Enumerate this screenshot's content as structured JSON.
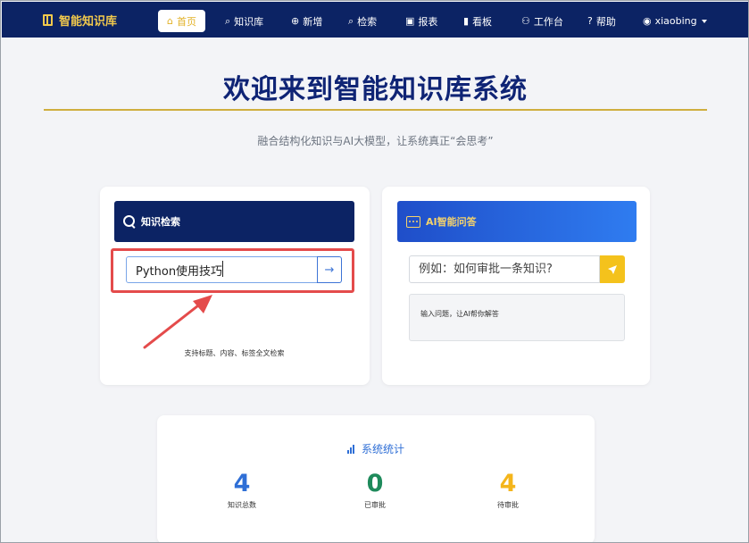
{
  "navbar": {
    "brand": "智能知识库",
    "items": [
      {
        "label": "首页",
        "icon": "home-icon",
        "glyph": "⌂",
        "active": true
      },
      {
        "label": "知识库",
        "icon": "search-icon",
        "glyph": "⌕"
      },
      {
        "label": "新增",
        "icon": "plus-circle-icon",
        "glyph": "⊕"
      },
      {
        "label": "检索",
        "icon": "search-icon",
        "glyph": "⌕"
      },
      {
        "label": "报表",
        "icon": "report-icon",
        "glyph": "▣"
      },
      {
        "label": "看板",
        "icon": "bar-chart-icon",
        "glyph": "▮"
      },
      {
        "label": "工作台",
        "icon": "user-icon",
        "glyph": "⚇"
      },
      {
        "label": "帮助",
        "icon": "help-icon",
        "glyph": "?"
      },
      {
        "label": "xiaobing",
        "icon": "user-circle-icon",
        "glyph": "◉"
      }
    ]
  },
  "hero": {
    "title": "欢迎来到智能知识库系统",
    "subtitle": "融合结构化知识与AI大模型，让系统真正“会思考”"
  },
  "search_panel": {
    "header": "知识检索",
    "input_value": "Python使用技巧",
    "button_glyph": "→",
    "hint": "支持标题、内容、标签全文检索"
  },
  "ai_panel": {
    "header": "AI智能问答",
    "placeholder": "例如：如何审批一条知识?",
    "answer_placeholder": "输入问题，让AI帮你解答"
  },
  "stats": {
    "title": "系统统计",
    "items": [
      {
        "value": "4",
        "label": "知识总数",
        "color": "#2f6fd6"
      },
      {
        "value": "0",
        "label": "已审批",
        "color": "#1e8a5b"
      },
      {
        "value": "4",
        "label": "待审批",
        "color": "#f4b51b"
      }
    ]
  },
  "colors": {
    "navbar": "#0c2364",
    "accent_gold": "#cfae3f",
    "annotation_red": "#e44b4b"
  }
}
